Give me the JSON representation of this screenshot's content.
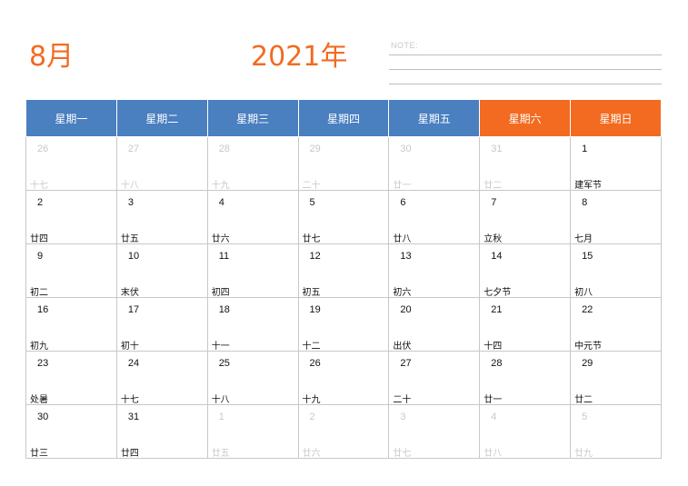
{
  "header": {
    "month": "8月",
    "year": "2021年",
    "note_label": "NOTE:"
  },
  "calendar": {
    "weekdays": [
      {
        "label": "星期一",
        "weekend": false
      },
      {
        "label": "星期二",
        "weekend": false
      },
      {
        "label": "星期三",
        "weekend": false
      },
      {
        "label": "星期四",
        "weekend": false
      },
      {
        "label": "星期五",
        "weekend": false
      },
      {
        "label": "星期六",
        "weekend": true
      },
      {
        "label": "星期日",
        "weekend": true
      }
    ],
    "weeks": [
      [
        {
          "day": "26",
          "lunar": "十七",
          "other_month": true
        },
        {
          "day": "27",
          "lunar": "十八",
          "other_month": true
        },
        {
          "day": "28",
          "lunar": "十九",
          "other_month": true
        },
        {
          "day": "29",
          "lunar": "二十",
          "other_month": true
        },
        {
          "day": "30",
          "lunar": "廿一",
          "other_month": true
        },
        {
          "day": "31",
          "lunar": "廿二",
          "other_month": true
        },
        {
          "day": "1",
          "lunar": "建军节",
          "other_month": false
        }
      ],
      [
        {
          "day": "2",
          "lunar": "廿四",
          "other_month": false
        },
        {
          "day": "3",
          "lunar": "廿五",
          "other_month": false
        },
        {
          "day": "4",
          "lunar": "廿六",
          "other_month": false
        },
        {
          "day": "5",
          "lunar": "廿七",
          "other_month": false
        },
        {
          "day": "6",
          "lunar": "廿八",
          "other_month": false
        },
        {
          "day": "7",
          "lunar": "立秋",
          "other_month": false
        },
        {
          "day": "8",
          "lunar": "七月",
          "other_month": false
        }
      ],
      [
        {
          "day": "9",
          "lunar": "初二",
          "other_month": false
        },
        {
          "day": "10",
          "lunar": "末伏",
          "other_month": false
        },
        {
          "day": "11",
          "lunar": "初四",
          "other_month": false
        },
        {
          "day": "12",
          "lunar": "初五",
          "other_month": false
        },
        {
          "day": "13",
          "lunar": "初六",
          "other_month": false
        },
        {
          "day": "14",
          "lunar": "七夕节",
          "other_month": false
        },
        {
          "day": "15",
          "lunar": "初八",
          "other_month": false
        }
      ],
      [
        {
          "day": "16",
          "lunar": "初九",
          "other_month": false
        },
        {
          "day": "17",
          "lunar": "初十",
          "other_month": false
        },
        {
          "day": "18",
          "lunar": "十一",
          "other_month": false
        },
        {
          "day": "19",
          "lunar": "十二",
          "other_month": false
        },
        {
          "day": "20",
          "lunar": "出伏",
          "other_month": false
        },
        {
          "day": "21",
          "lunar": "十四",
          "other_month": false
        },
        {
          "day": "22",
          "lunar": "中元节",
          "other_month": false
        }
      ],
      [
        {
          "day": "23",
          "lunar": "处暑",
          "other_month": false
        },
        {
          "day": "24",
          "lunar": "十七",
          "other_month": false
        },
        {
          "day": "25",
          "lunar": "十八",
          "other_month": false
        },
        {
          "day": "26",
          "lunar": "十九",
          "other_month": false
        },
        {
          "day": "27",
          "lunar": "二十",
          "other_month": false
        },
        {
          "day": "28",
          "lunar": "廿一",
          "other_month": false
        },
        {
          "day": "29",
          "lunar": "廿二",
          "other_month": false
        }
      ],
      [
        {
          "day": "30",
          "lunar": "廿三",
          "other_month": false
        },
        {
          "day": "31",
          "lunar": "廿四",
          "other_month": false
        },
        {
          "day": "1",
          "lunar": "廿五",
          "other_month": true
        },
        {
          "day": "2",
          "lunar": "廿六",
          "other_month": true
        },
        {
          "day": "3",
          "lunar": "廿七",
          "other_month": true
        },
        {
          "day": "4",
          "lunar": "廿八",
          "other_month": true
        },
        {
          "day": "5",
          "lunar": "廿九",
          "other_month": true
        }
      ]
    ]
  },
  "colors": {
    "accent_orange": "#f26b21",
    "weekday_blue": "#4a7fc0",
    "grid": "#c8c8c8",
    "muted_text": "#c8c8c8"
  }
}
